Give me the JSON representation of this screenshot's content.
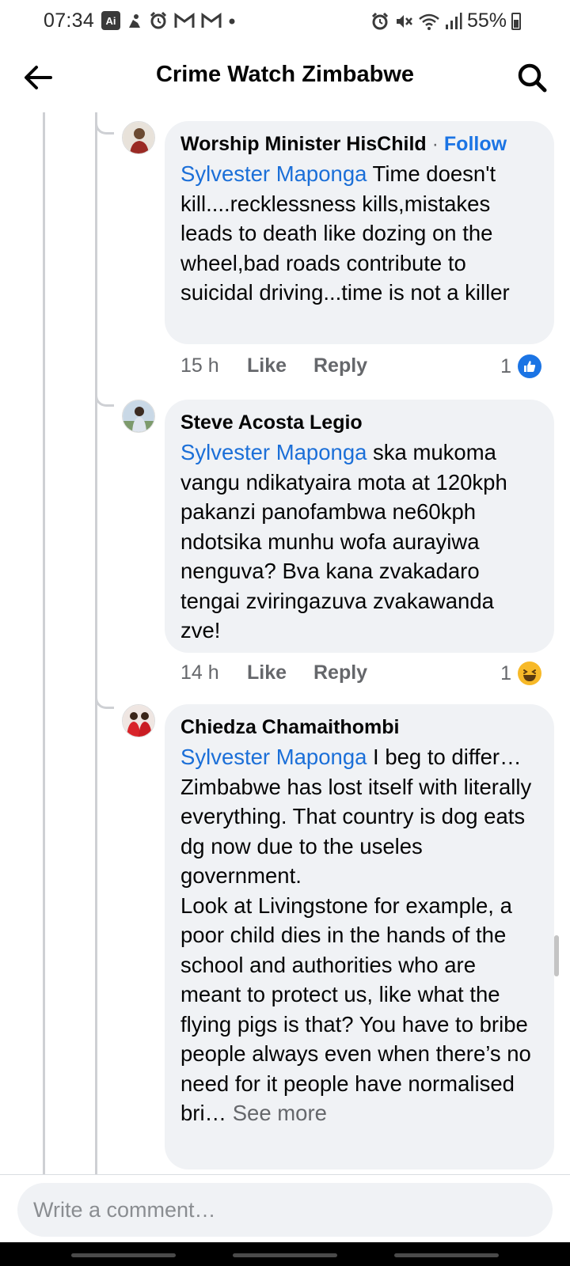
{
  "status_bar": {
    "time": "07:34",
    "ai_badge": "Ai",
    "battery": "55%",
    "left_icons": [
      "ai-icon",
      "bixby-icon",
      "alarm-icon",
      "gmail-icon",
      "gmail-icon",
      "dot-icon"
    ],
    "right_icons": [
      "alarm-icon",
      "mute-icon",
      "wifi-icon",
      "signal-icon",
      "battery-icon"
    ]
  },
  "header": {
    "title": "Crime Watch Zimbabwe"
  },
  "comments": [
    {
      "author": "Worship Minister HisChild",
      "follow_label": "Follow",
      "separator": "·",
      "mention": "Sylvester Maponga",
      "text": " Time doesn't kill....recklessness kills,mistakes leads to death like dozing on the wheel,bad roads contribute to suicidal driving...time is not a killer",
      "time": "15 h",
      "like_label": "Like",
      "reply_label": "Reply",
      "reaction_count": "1",
      "reaction": "like-reaction-icon",
      "reaction_color": "#1b74e4"
    },
    {
      "author": "Steve Acosta Legio",
      "mention": "Sylvester Maponga",
      "text": " ska mukoma vangu ndikatyaira mota at 120kph pakanzi panofambwa ne60kph  ndotsika munhu wofa aurayiwa nenguva? Bva kana zvakadaro tengai zviringazuva zvakawanda zve!",
      "time": "14 h",
      "like_label": "Like",
      "reply_label": "Reply",
      "reaction_count": "1",
      "reaction": "haha-reaction-icon",
      "reaction_color": "#f7b928"
    },
    {
      "author": "Chiedza Chamaithombi",
      "mention": "Sylvester Maponga",
      "text": " I beg to differ… Zimbabwe has lost itself with literally everything. That country is dog eats dg now due to the useles government.\nLook at Livingstone for example, a poor child dies in the hands of the school and authorities who are meant to protect us,  like what the flying pigs is that? You have to bribe people always even when there’s no need for it people have normalised bri…",
      "see_more": " See more"
    }
  ],
  "composer": {
    "placeholder": "Write a comment…"
  },
  "colors": {
    "accent": "#1b74e4",
    "mention": "#1b6fd8",
    "bubble": "#f0f2f5",
    "secondary_text": "#65676b"
  }
}
